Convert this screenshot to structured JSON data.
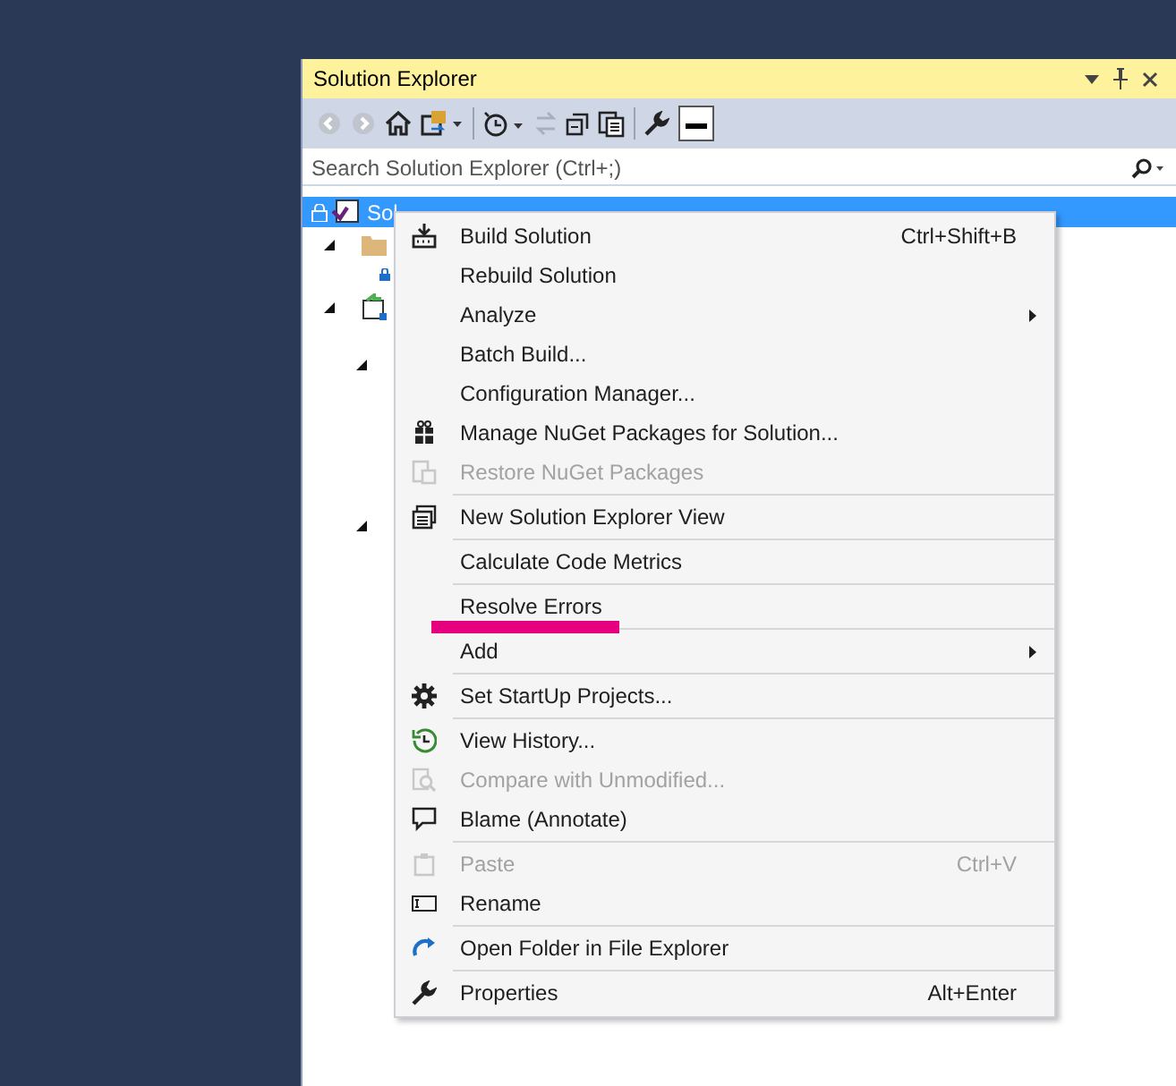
{
  "panel": {
    "title": "Solution Explorer"
  },
  "search": {
    "placeholder": "Search Solution Explorer (Ctrl+;)"
  },
  "tree": {
    "selected_row": {
      "label": "Sol",
      "selected": true
    }
  },
  "context_menu": [
    {
      "kind": "item",
      "label": "Build Solution",
      "shortcut": "Ctrl+Shift+B",
      "disabled": false,
      "submenu": false
    },
    {
      "kind": "item",
      "label": "Rebuild Solution",
      "disabled": false,
      "submenu": false
    },
    {
      "kind": "item",
      "label": "Analyze",
      "disabled": false,
      "submenu": true
    },
    {
      "kind": "item",
      "label": "Batch Build...",
      "disabled": false,
      "submenu": false
    },
    {
      "kind": "item",
      "label": "Configuration Manager...",
      "disabled": false,
      "submenu": false
    },
    {
      "kind": "item",
      "label": "Manage NuGet Packages for Solution...",
      "disabled": false,
      "submenu": false
    },
    {
      "kind": "item",
      "label": "Restore NuGet Packages",
      "disabled": true,
      "submenu": false
    },
    {
      "kind": "separator"
    },
    {
      "kind": "item",
      "label": "New Solution Explorer View",
      "disabled": false,
      "submenu": false
    },
    {
      "kind": "separator"
    },
    {
      "kind": "item",
      "label": "Calculate Code Metrics",
      "disabled": false,
      "submenu": false
    },
    {
      "kind": "separator"
    },
    {
      "kind": "item",
      "label": "Resolve Errors",
      "disabled": false,
      "submenu": false,
      "marked": true
    },
    {
      "kind": "separator"
    },
    {
      "kind": "item",
      "label": "Add",
      "disabled": false,
      "submenu": true
    },
    {
      "kind": "separator"
    },
    {
      "kind": "item",
      "label": "Set StartUp Projects...",
      "disabled": false,
      "submenu": false
    },
    {
      "kind": "separator"
    },
    {
      "kind": "item",
      "label": "View History...",
      "disabled": false,
      "submenu": false
    },
    {
      "kind": "item",
      "label": "Compare with Unmodified...",
      "disabled": true,
      "submenu": false
    },
    {
      "kind": "item",
      "label": "Blame (Annotate)",
      "disabled": false,
      "submenu": false
    },
    {
      "kind": "separator"
    },
    {
      "kind": "item",
      "label": "Paste",
      "shortcut": "Ctrl+V",
      "disabled": true,
      "submenu": false
    },
    {
      "kind": "item",
      "label": "Rename",
      "disabled": false,
      "submenu": false
    },
    {
      "kind": "separator"
    },
    {
      "kind": "item",
      "label": "Open Folder in File Explorer",
      "disabled": false,
      "submenu": false
    },
    {
      "kind": "separator"
    },
    {
      "kind": "item",
      "label": "Properties",
      "shortcut": "Alt+Enter",
      "disabled": false,
      "submenu": false
    }
  ]
}
